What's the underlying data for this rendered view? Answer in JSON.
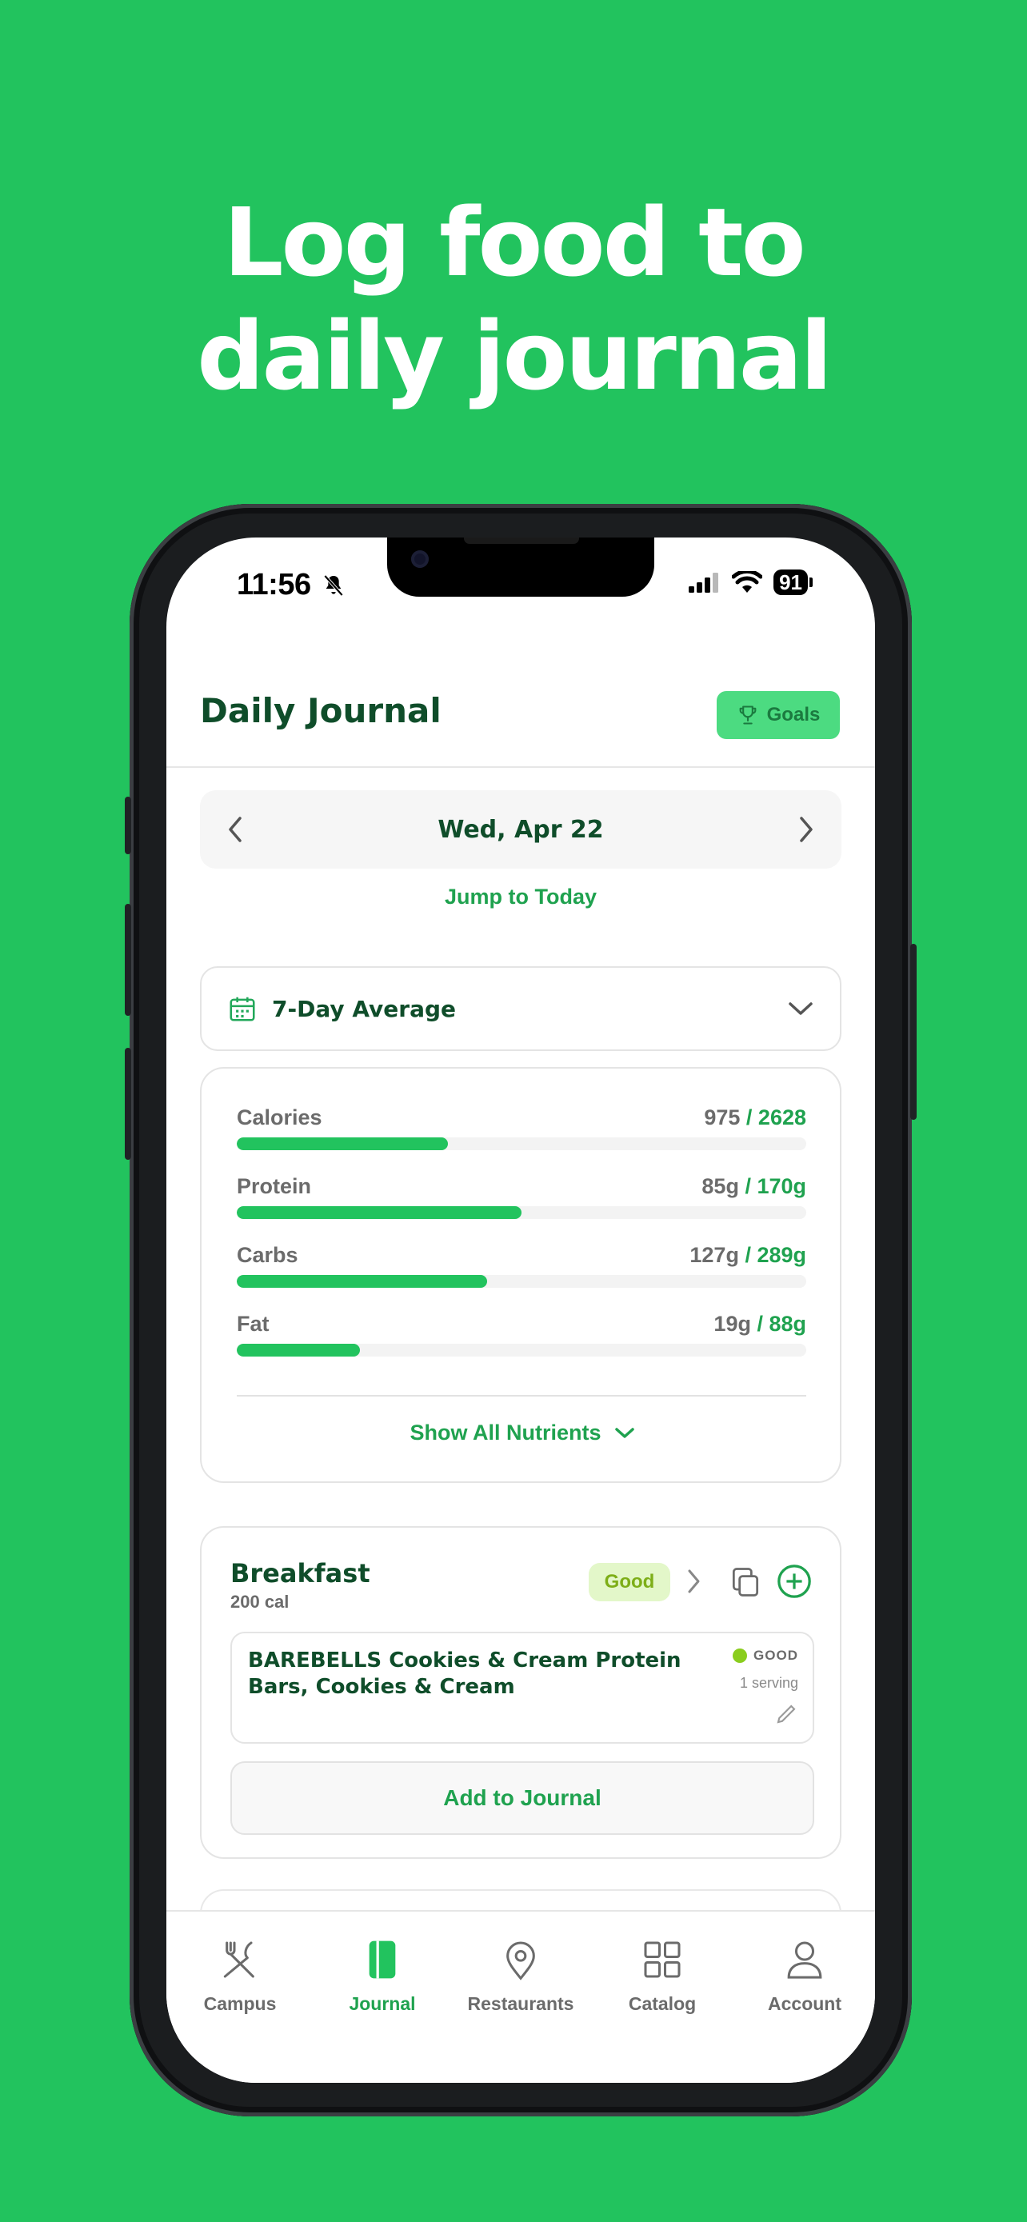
{
  "headline": {
    "line1": "Log food to",
    "line2": "daily journal"
  },
  "status_bar": {
    "time": "11:56",
    "battery": "91"
  },
  "header": {
    "title": "Daily Journal",
    "goals_label": "Goals"
  },
  "date_nav": {
    "date": "Wed, Apr 22",
    "jump_today": "Jump to Today"
  },
  "average": {
    "title": "7-Day Average"
  },
  "nutrients": {
    "items": [
      {
        "label": "Calories",
        "current": "975",
        "goal": "/ 2628",
        "progress": 0.371
      },
      {
        "label": "Protein",
        "current": "85g",
        "goal": "/ 170g",
        "progress": 0.5
      },
      {
        "label": "Carbs",
        "current": "127g",
        "goal": "/ 289g",
        "progress": 0.439
      },
      {
        "label": "Fat",
        "current": "19g",
        "goal": "/ 88g",
        "progress": 0.216
      }
    ],
    "show_all": "Show All Nutrients"
  },
  "meal": {
    "title": "Breakfast",
    "calories": "200 cal",
    "badge": "Good",
    "items": [
      {
        "name": "BAREBELLS Cookies & Cream Protein Bars, Cookies & Cream",
        "rating": "GOOD",
        "serving": "1 serving"
      }
    ],
    "add_label": "Add to Journal"
  },
  "tabs": [
    {
      "label": "Campus",
      "icon": "fork-knife-icon"
    },
    {
      "label": "Journal",
      "icon": "journal-icon"
    },
    {
      "label": "Restaurants",
      "icon": "map-pin-icon"
    },
    {
      "label": "Catalog",
      "icon": "grid-icon"
    },
    {
      "label": "Account",
      "icon": "person-icon"
    }
  ],
  "colors": {
    "brand_green": "#22C35E",
    "dark_green": "#0F4D2A",
    "accent_green": "#1FA24F",
    "good_badge": "#E3F7C9"
  }
}
